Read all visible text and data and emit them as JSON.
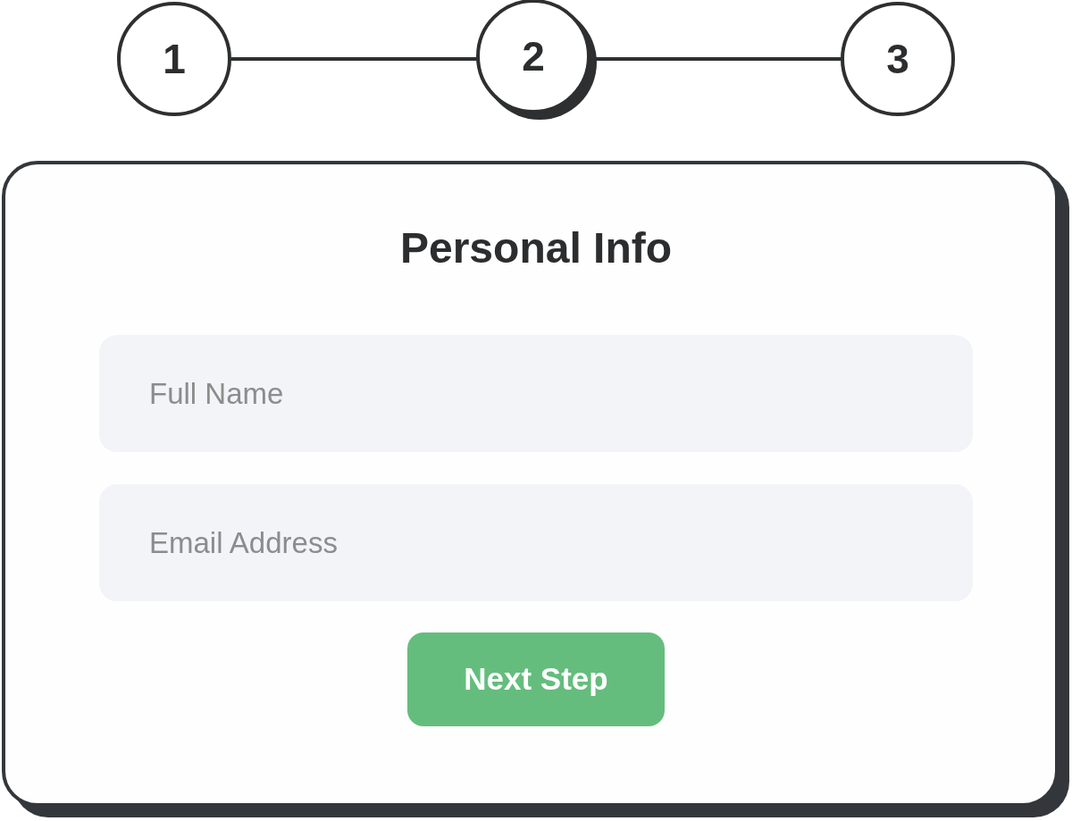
{
  "stepper": {
    "steps": [
      {
        "label": "1",
        "selected": false
      },
      {
        "label": "2",
        "selected": true
      },
      {
        "label": "3",
        "selected": false
      }
    ]
  },
  "form": {
    "title": "Personal Info",
    "fields": [
      {
        "placeholder": "Full Name"
      },
      {
        "placeholder": "Email Address"
      }
    ],
    "submit_button": "Next Step"
  }
}
